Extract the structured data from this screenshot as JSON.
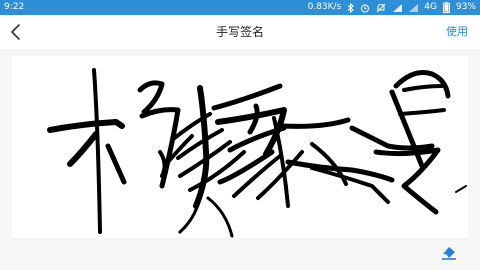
{
  "status_bar": {
    "time": "9:22",
    "network_speed": "0.83K/s",
    "network_type": "4G",
    "battery": "93%",
    "icons": [
      "bluetooth-icon",
      "alarm-icon",
      "mute-icon",
      "wifi-icon",
      "signal-icon",
      "battery-icon"
    ]
  },
  "header": {
    "title": "手写签名",
    "back_icon": "back-arrow-icon",
    "action_label": "使用"
  },
  "signature": {
    "text": "杨豫曼"
  },
  "toolbar": {
    "eraser_icon": "eraser-icon"
  },
  "colors": {
    "status_bar": "#2e8fd6",
    "accent": "#1a8ee8",
    "ink": "#000000",
    "canvas_background": "#f6f6f6"
  }
}
